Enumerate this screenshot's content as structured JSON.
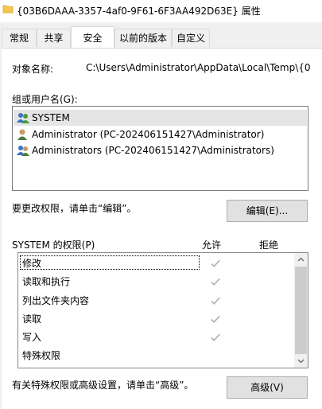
{
  "window": {
    "title": "{03B6DAAA-3357-4af0-9F61-6F3AA492D63E} 属性"
  },
  "tabs": [
    {
      "label": "常规"
    },
    {
      "label": "共享"
    },
    {
      "label": "安全"
    },
    {
      "label": "以前的版本"
    },
    {
      "label": "自定义"
    }
  ],
  "security": {
    "object_name_label": "对象名称:",
    "object_name_value": "C:\\Users\\Administrator\\AppData\\Local\\Temp\\{0",
    "groups_label": "组或用户名(G):",
    "users": [
      {
        "name": "SYSTEM",
        "icon": "group-users-icon"
      },
      {
        "name": "Administrator (PC-202406151427\\Administrator)",
        "icon": "user-icon"
      },
      {
        "name": "Administrators (PC-202406151427\\Administrators)",
        "icon": "group-users-icon"
      }
    ],
    "edit_hint": "要更改权限，请单击“编辑”。",
    "edit_button": "编辑(E)...",
    "permissions_label": "SYSTEM 的权限(P)",
    "allow_header": "允许",
    "deny_header": "拒绝",
    "permissions": [
      {
        "name": "修改",
        "allow": true,
        "deny": false
      },
      {
        "name": "读取和执行",
        "allow": true,
        "deny": false
      },
      {
        "name": "列出文件夹内容",
        "allow": true,
        "deny": false
      },
      {
        "name": "读取",
        "allow": true,
        "deny": false
      },
      {
        "name": "写入",
        "allow": true,
        "deny": false
      },
      {
        "name": "特殊权限",
        "allow": false,
        "deny": false
      }
    ],
    "advanced_hint": "有关特殊权限或高级设置，请单击“高级”。",
    "advanced_button": "高级(V)"
  },
  "colors": {
    "check": "#b0b0b0",
    "user_blue": "#3a73c8",
    "user_green": "#4c9a3c"
  }
}
